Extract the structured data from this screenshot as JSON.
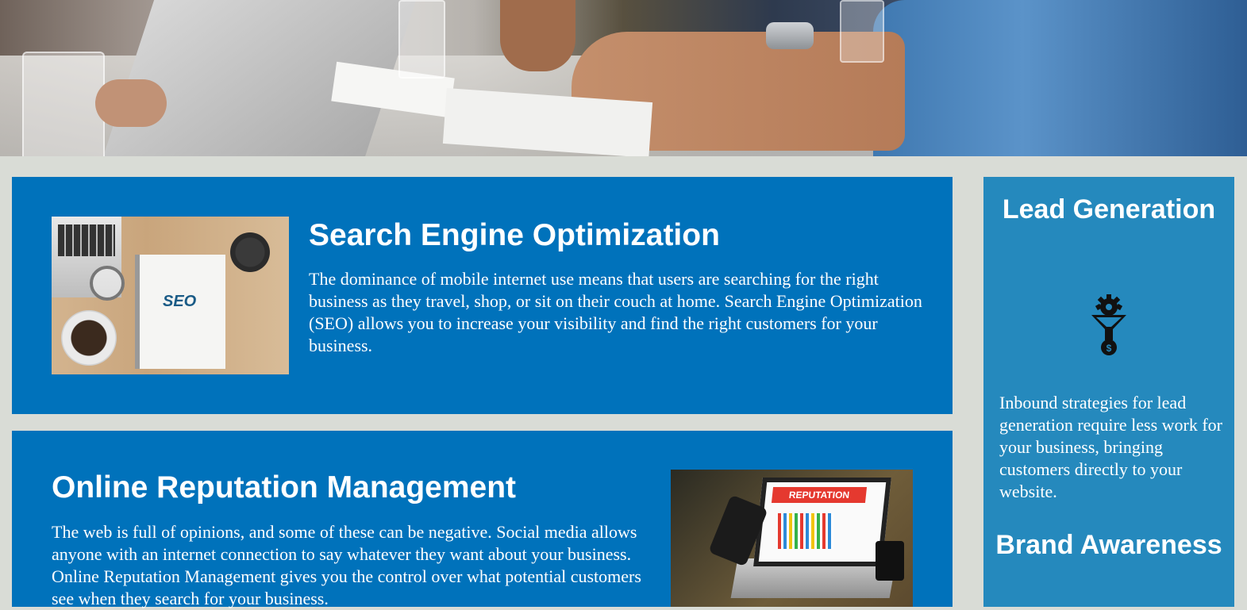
{
  "hero": {
    "image": "team-meeting-photo"
  },
  "services": [
    {
      "title": "Search Engine Optimization",
      "body": "The dominance of mobile internet use means that users are searching for the right business as they travel, shop, or sit on their couch at home. Search Engine Optimization (SEO) allows you to increase your visibility and find the right customers for your business.",
      "image_text": "SEO"
    },
    {
      "title": "Online Reputation Management",
      "body": "The web is full of opinions, and some of these can be negative. Social media allows anyone with an internet connection to say whatever they want about your business. Online Reputation Management gives you the control over what potential customers see when they search for your business.",
      "image_text": "REPUTATION"
    }
  ],
  "sidebar": {
    "benefits": [
      {
        "title": "Lead Generation",
        "icon": "lead-generation-icon",
        "body": "Inbound strategies for lead generation require less work for your business, bringing customers directly to your website."
      },
      {
        "title": "Brand Awareness"
      }
    ]
  },
  "colors": {
    "page_background": "#d9dcd6",
    "card_background": "#0072bb",
    "sidebar_background": "#2589bd",
    "text": "#ffffff"
  }
}
